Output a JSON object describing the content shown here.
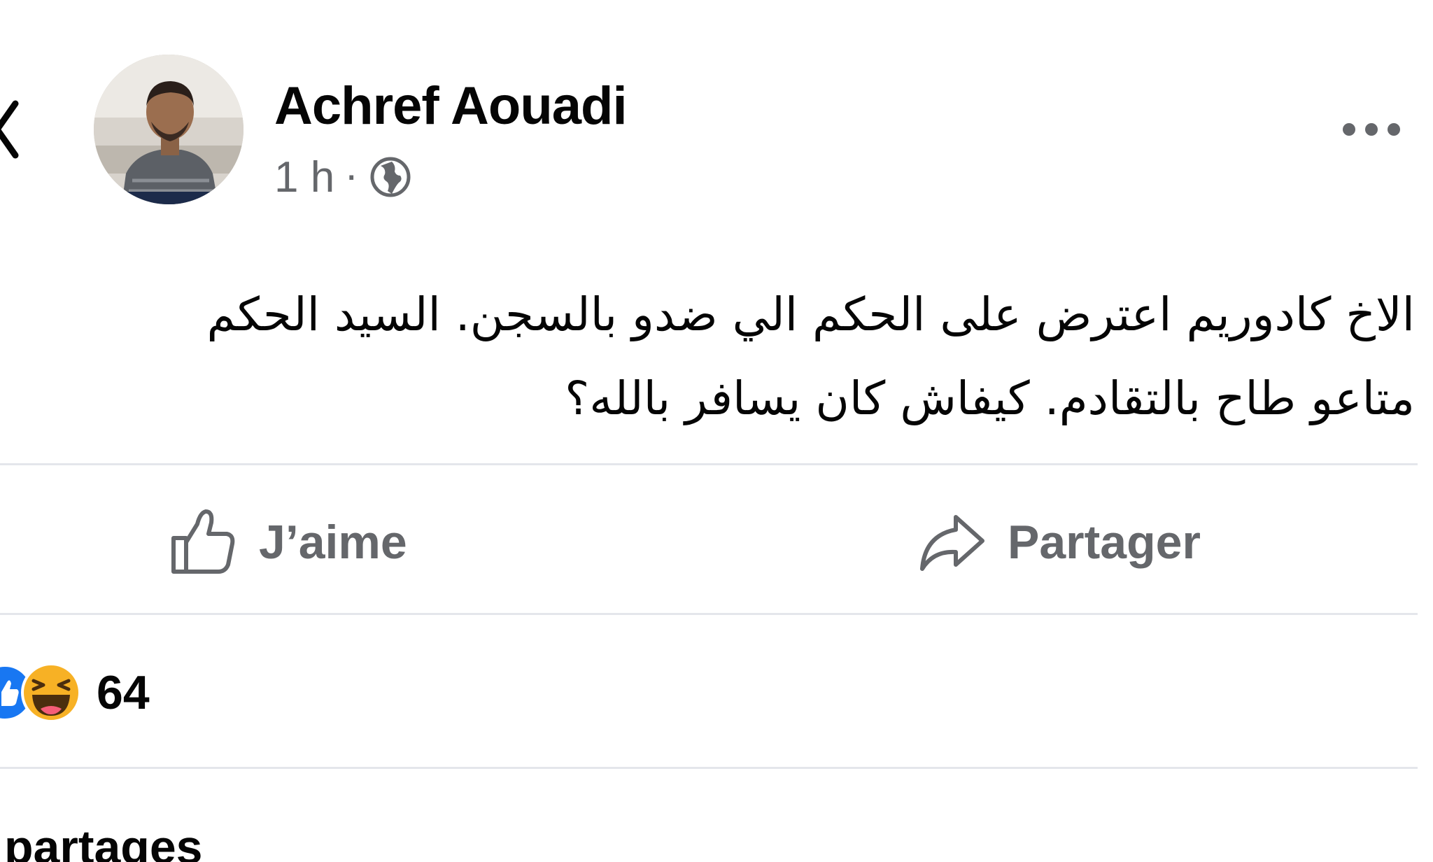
{
  "post": {
    "author": "Achref Aouadi",
    "time": "1 h",
    "separator": "·",
    "visibility_icon": "globe-icon",
    "text_line_1": "الاخ كادوريم اعترض على الحكم الي ضدو بالسجن. السيد الحكم",
    "text_line_2": "متاعو طاح بالتقادم. كيفاش كان يسافر بالله؟"
  },
  "actions": {
    "like_label": "J’aime",
    "like_icon": "thumbs-up-icon",
    "share_label": "Partager",
    "share_icon": "share-arrow-icon"
  },
  "reactions": {
    "count": "64",
    "icons": [
      "like-reaction-icon",
      "haha-reaction-icon"
    ]
  },
  "footer": {
    "shares_label": "partages"
  },
  "colors": {
    "text_primary": "#050505",
    "text_secondary": "#65676b",
    "divider": "#e4e6eb",
    "like_blue": "#1877f2",
    "haha_yellow": "#f7b125"
  }
}
